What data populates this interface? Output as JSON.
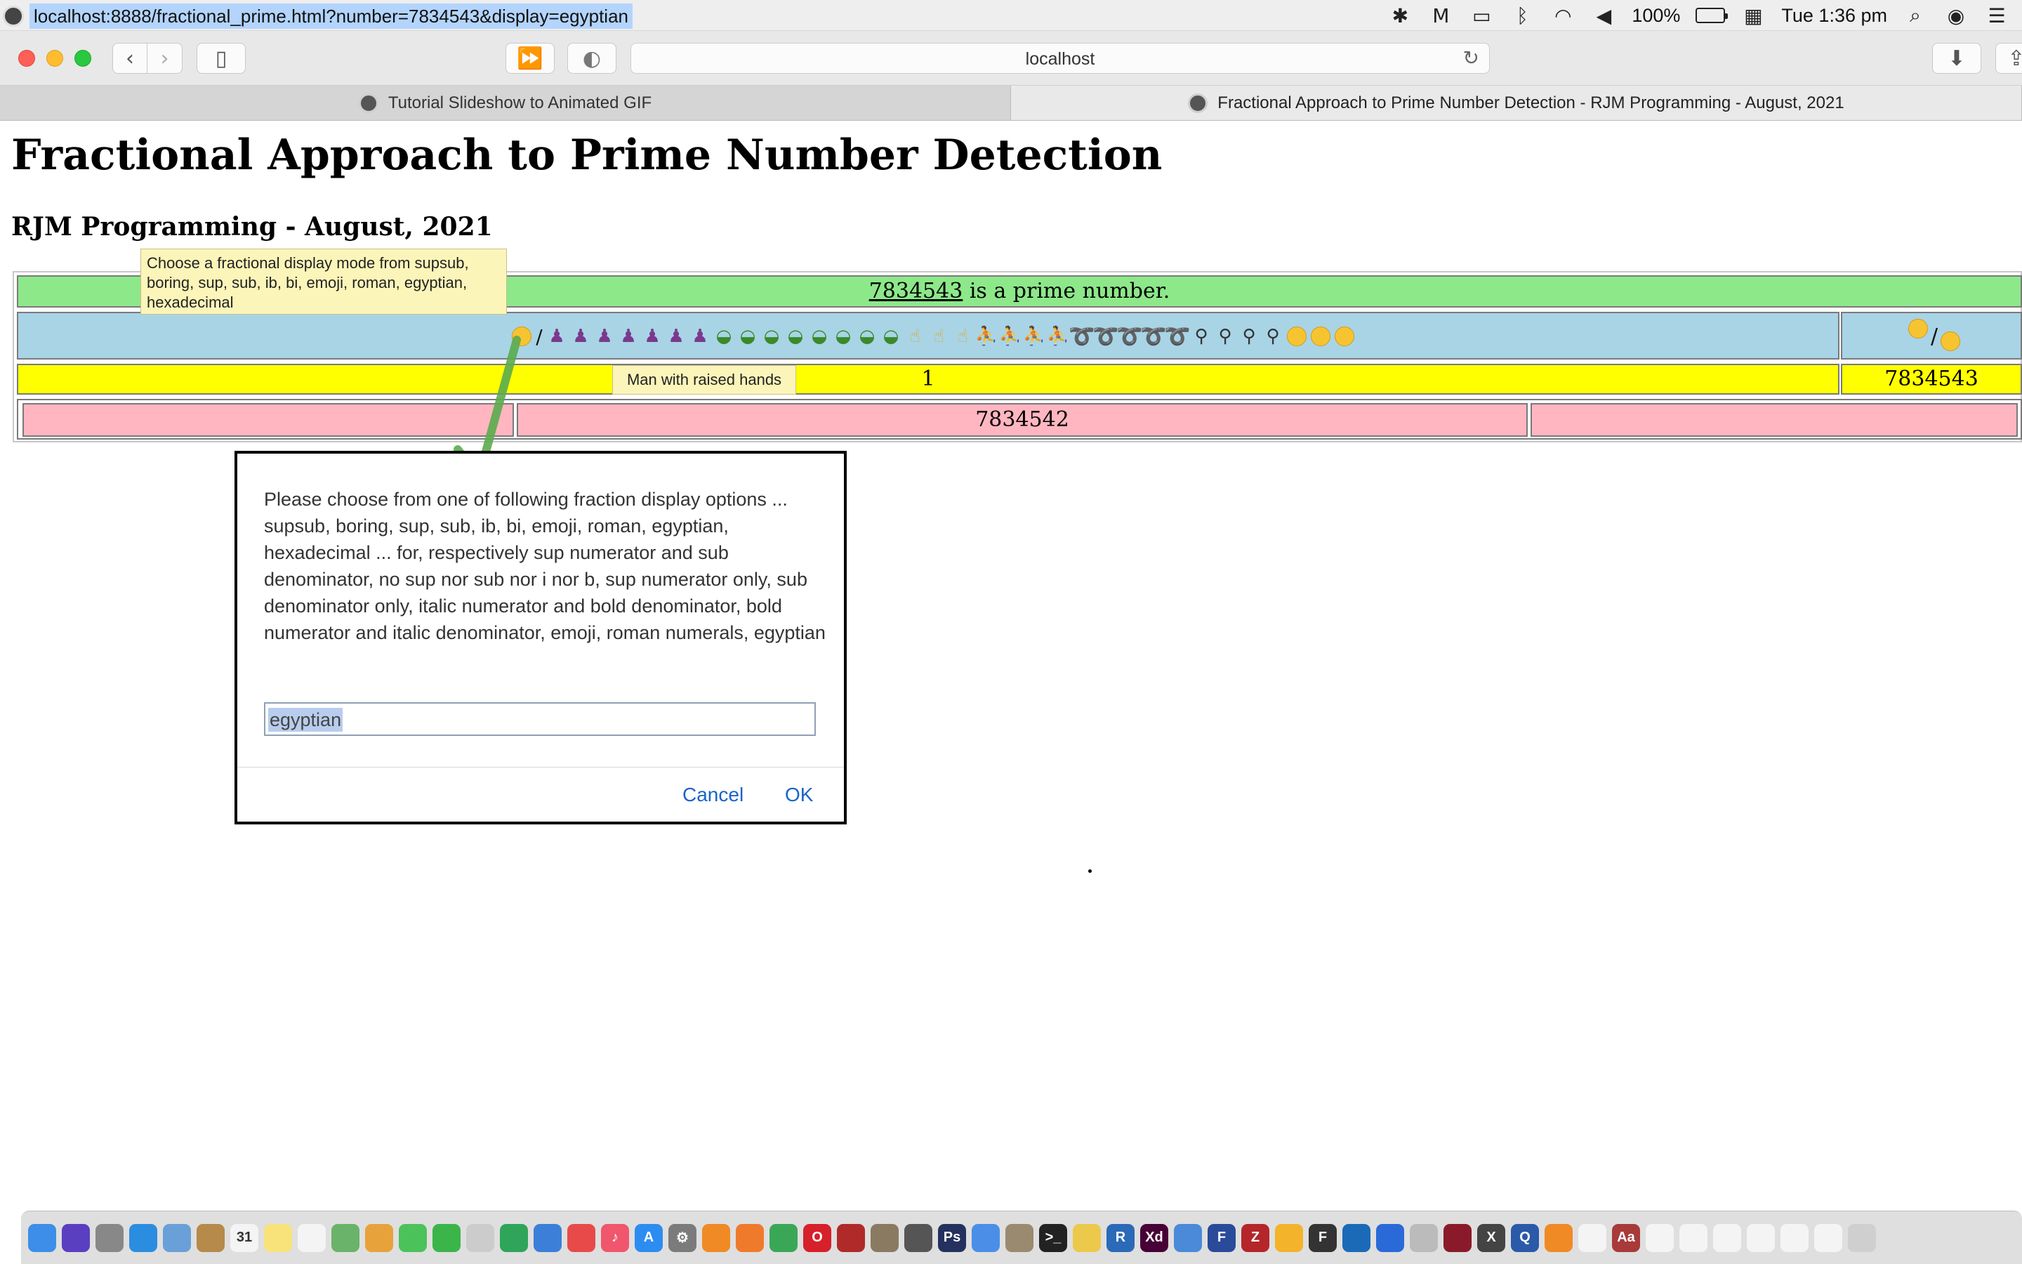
{
  "menubar": {
    "url_text": "localhost:8888/fractional_prime.html?number=7834543&display=egyptian",
    "battery_percent": "100%",
    "clock": "Tue 1:36 pm",
    "tray_icons": [
      "monitor-icon",
      "malwarebytes-icon",
      "airplay-icon",
      "bluetooth-icon",
      "wifi-icon",
      "volume-icon",
      "battery-icon",
      "calendar-icon",
      "search-icon",
      "siri-icon",
      "list-icon"
    ]
  },
  "toolbar": {
    "address": "localhost",
    "back_glyph": "‹",
    "forward_glyph": "›",
    "sidebar_glyph": "▯",
    "ff_glyph": "⏩",
    "shield_glyph": "◐",
    "reload_glyph": "↻",
    "download_glyph": "⬇",
    "share_glyph": "⇪"
  },
  "tabs": [
    {
      "label": "Tutorial Slideshow to Animated GIF"
    },
    {
      "label": "Fractional Approach to Prime Number Detection - RJM Programming - August, 2021"
    }
  ],
  "page": {
    "title": "Fractional Approach to Prime Number Detection",
    "subtitle": "RJM Programming - August, 2021",
    "prime_number": "7834543",
    "prime_suffix": " is a prime number.",
    "numerator_value": "1",
    "denominator_value": "7834543",
    "pink_value": "7834542",
    "slash": "/"
  },
  "tooltips": {
    "mode": "Choose a fractional display mode from supsub, boring, sup, sub, ib, bi, emoji, roman, egyptian, hexadecimal",
    "emoji": "Man with raised hands"
  },
  "dialog": {
    "message": "Please choose from one of following fraction display options ... supsub, boring, sup, sub, ib, bi, emoji, roman, egyptian, hexadecimal ... for, respectively sup numerator and sub denominator, no sup nor sub nor i nor b, sup numerator only, sub denominator only,  italic numerator and bold denominator, bold numerator and italic denominator, emoji, roman numerals, egyptian",
    "input_value": "egyptian",
    "cancel_label": "Cancel",
    "ok_label": "OK"
  },
  "colors": {
    "green_row": "#8de88a",
    "blue_row": "#a8d4e6",
    "yellow_row": "#ffff00",
    "pink_row": "#ffb6c1",
    "tooltip_bg": "#fbf5b9",
    "arrow": "#5bab4e",
    "link_blue": "#1a64c8"
  },
  "dock": {
    "apps": [
      {
        "name": "finder",
        "color": "#3d8ee8",
        "glyph": ""
      },
      {
        "name": "siri",
        "color": "#5a3fc0",
        "glyph": ""
      },
      {
        "name": "launchpad",
        "color": "#888888",
        "glyph": ""
      },
      {
        "name": "safari",
        "color": "#2b8de0",
        "glyph": ""
      },
      {
        "name": "preview",
        "color": "#6aa0d8",
        "glyph": ""
      },
      {
        "name": "notebook",
        "color": "#b58a4a",
        "glyph": ""
      },
      {
        "name": "calendar",
        "color": "#f4f4f4",
        "glyph": "31"
      },
      {
        "name": "notes",
        "color": "#f8e27a",
        "glyph": ""
      },
      {
        "name": "reminders",
        "color": "#f4f4f4",
        "glyph": ""
      },
      {
        "name": "maps",
        "color": "#6ab36a",
        "glyph": ""
      },
      {
        "name": "photos",
        "color": "#e8a23c",
        "glyph": ""
      },
      {
        "name": "messages",
        "color": "#4cc25a",
        "glyph": ""
      },
      {
        "name": "facetime",
        "color": "#3bb54a",
        "glyph": ""
      },
      {
        "name": "textedit",
        "color": "#cccccc",
        "glyph": ""
      },
      {
        "name": "numbers",
        "color": "#2fa55a",
        "glyph": ""
      },
      {
        "name": "keynote",
        "color": "#3c7fd8",
        "glyph": ""
      },
      {
        "name": "news",
        "color": "#e84a4a",
        "glyph": ""
      },
      {
        "name": "music",
        "color": "#f0566c",
        "glyph": "♪"
      },
      {
        "name": "app-store",
        "color": "#2d8cf0",
        "glyph": "A"
      },
      {
        "name": "system-preferences",
        "color": "#7b7b7b",
        "glyph": "⚙"
      },
      {
        "name": "blender",
        "color": "#f08a24",
        "glyph": ""
      },
      {
        "name": "firefox",
        "color": "#ef7a2c",
        "glyph": ""
      },
      {
        "name": "chrome",
        "color": "#3aa757",
        "glyph": ""
      },
      {
        "name": "opera",
        "color": "#d6202a",
        "glyph": "O"
      },
      {
        "name": "photo-booth",
        "color": "#b02a2a",
        "glyph": ""
      },
      {
        "name": "gimp",
        "color": "#8a7a62",
        "glyph": ""
      },
      {
        "name": "mamp",
        "color": "#555555",
        "glyph": ""
      },
      {
        "name": "photoshop",
        "color": "#24315e",
        "glyph": "Ps"
      },
      {
        "name": "mail",
        "color": "#4a8ee8",
        "glyph": ""
      },
      {
        "name": "fugu",
        "color": "#9a8a70",
        "glyph": ""
      },
      {
        "name": "terminal",
        "color": "#222222",
        "glyph": ">_"
      },
      {
        "name": "cyberduck",
        "color": "#ecc94b",
        "glyph": ""
      },
      {
        "name": "r",
        "color": "#2a6ab8",
        "glyph": "R"
      },
      {
        "name": "xd",
        "color": "#470137",
        "glyph": "Xd"
      },
      {
        "name": "thunderbird",
        "color": "#4a8ad8",
        "glyph": ""
      },
      {
        "name": "flow",
        "color": "#2a4a9a",
        "glyph": "F"
      },
      {
        "name": "filezilla",
        "color": "#b4262a",
        "glyph": "Z"
      },
      {
        "name": "audacity",
        "color": "#f3b32a",
        "glyph": ""
      },
      {
        "name": "font-forge",
        "color": "#333333",
        "glyph": "F"
      },
      {
        "name": "virtualbox",
        "color": "#1a6ab8",
        "glyph": ""
      },
      {
        "name": "accessibility",
        "color": "#2a6ad8",
        "glyph": ""
      },
      {
        "name": "script-editor",
        "color": "#bbbbbb",
        "glyph": ""
      },
      {
        "name": "wine",
        "color": "#8a1a2a",
        "glyph": ""
      },
      {
        "name": "x11",
        "color": "#444444",
        "glyph": "X"
      },
      {
        "name": "quicktime",
        "color": "#2a5aa8",
        "glyph": "Q"
      },
      {
        "name": "books",
        "color": "#f08a24",
        "glyph": ""
      },
      {
        "name": "pages",
        "color": "#f4f4f4",
        "glyph": ""
      },
      {
        "name": "dictionary",
        "color": "#a83a3a",
        "glyph": "Aa"
      },
      {
        "name": "document-1",
        "color": "#f4f4f4",
        "glyph": ""
      },
      {
        "name": "document-2",
        "color": "#f4f4f4",
        "glyph": ""
      },
      {
        "name": "document-3",
        "color": "#f4f4f4",
        "glyph": ""
      },
      {
        "name": "document-4",
        "color": "#f4f4f4",
        "glyph": ""
      },
      {
        "name": "document-5",
        "color": "#f4f4f4",
        "glyph": ""
      },
      {
        "name": "document-6",
        "color": "#f4f4f4",
        "glyph": ""
      },
      {
        "name": "trash",
        "color": "#cfcfcf",
        "glyph": ""
      }
    ]
  }
}
